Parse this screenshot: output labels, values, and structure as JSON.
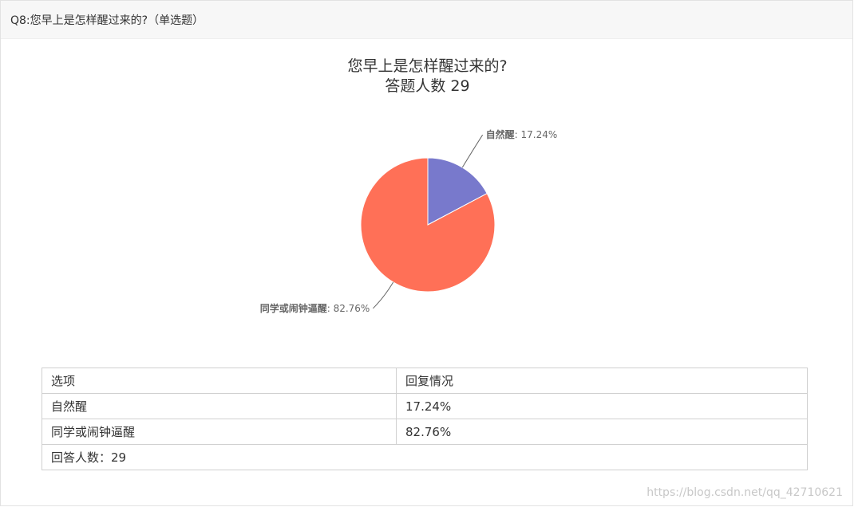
{
  "header": {
    "question_label": "Q8:您早上是怎样醒过来的?（单选题）"
  },
  "chart_data": {
    "type": "pie",
    "title": "您早上是怎样醒过来的?",
    "subtitle": "答题人数 29",
    "categories": [
      "自然醒",
      "同学或闹钟逼醒"
    ],
    "values": [
      17.24,
      82.76
    ],
    "value_labels": [
      "17.24%",
      "82.76%"
    ],
    "colors": [
      "#7879cc",
      "#ff7057"
    ],
    "legend": "none"
  },
  "table": {
    "headers": [
      "选项",
      "回复情况"
    ],
    "rows": [
      [
        "自然醒",
        "17.24%"
      ],
      [
        "同学或闹钟逼醒",
        "82.76%"
      ]
    ],
    "footer": "回答人数：29"
  },
  "watermark": "https://blog.csdn.net/qq_42710621"
}
